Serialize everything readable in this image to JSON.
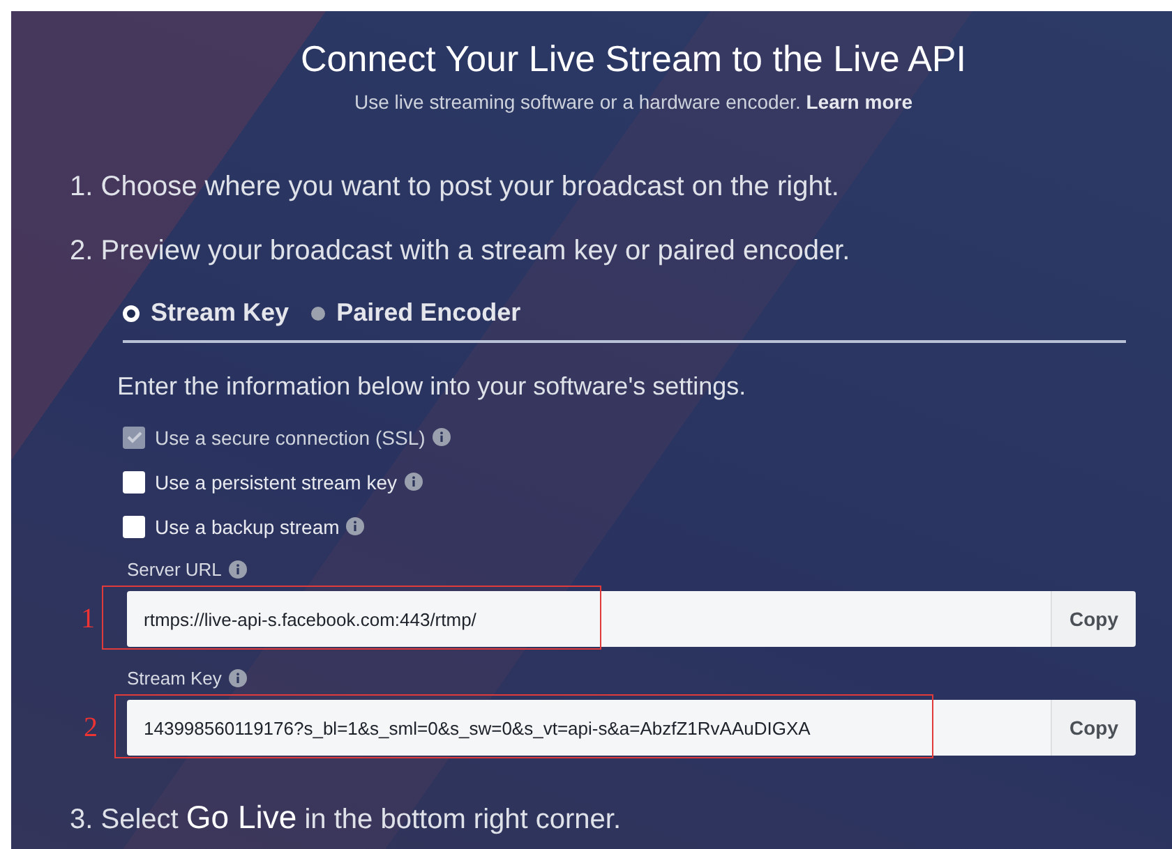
{
  "header": {
    "title": "Connect Your Live Stream to the Live API",
    "subtitle": "Use live streaming software or a hardware encoder.",
    "subtitle_link": "Learn more"
  },
  "steps": [
    {
      "number": "1.",
      "text": "Choose where you want to post your broadcast on the right."
    },
    {
      "number": "2.",
      "text": "Preview your broadcast with a stream key or paired encoder."
    }
  ],
  "tabs": [
    {
      "label": "Stream Key",
      "selected": true
    },
    {
      "label": "Paired Encoder",
      "selected": false
    }
  ],
  "instructions": "Enter the information below into your software's settings.",
  "options": [
    {
      "label": "Use a secure connection (SSL)",
      "checked": true,
      "disabled": true
    },
    {
      "label": "Use a persistent stream key",
      "checked": false,
      "disabled": false
    },
    {
      "label": "Use a backup stream",
      "checked": false,
      "disabled": false
    }
  ],
  "fields": [
    {
      "label": "Server URL",
      "value": "rtmps://live-api-s.facebook.com:443/rtmp/",
      "button": "Copy",
      "annotation": "1"
    },
    {
      "label": "Stream Key",
      "value": "143998560119176?s_bl=1&s_sml=0&s_sw=0&s_vt=api-s&a=AbzfZ1RvAAuDIGXA",
      "button": "Copy",
      "annotation": "2"
    }
  ],
  "final_step": {
    "number": "3.",
    "text_before": "Select",
    "highlight": "Go Live",
    "text_after": "in the bottom right corner."
  }
}
